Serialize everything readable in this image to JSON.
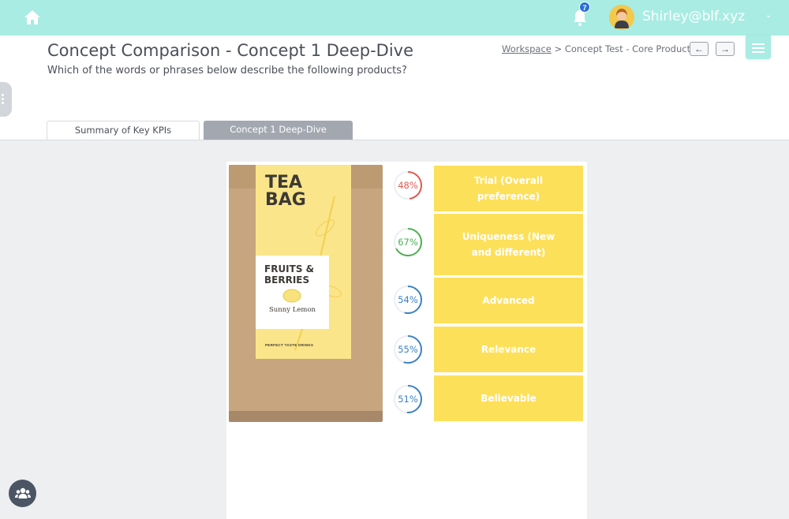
{
  "topbar": {
    "bg_color": "#a8ece3",
    "home_icon": "home-icon",
    "notification_icon": "bell-icon",
    "notification_count": "7",
    "user": "Shirley@blf.xyz",
    "user_menu_icon": "chevron-down-icon"
  },
  "header": {
    "title": "Concept Comparison - Concept 1 Deep-Dive",
    "subtitle": "Which of the words or phrases below describe the following products?",
    "breadcrumb": {
      "link": "Workspace",
      "separator": ">",
      "current": "Concept Test - Core Product"
    },
    "prev_icon": "arrow-left-icon",
    "next_icon": "arrow-right-icon",
    "menu_icon": "hamburger-icon"
  },
  "tabs": [
    {
      "label": "Summary of Key KPIs",
      "active": false
    },
    {
      "label": "Concept 1 Deep-Dive",
      "active": true
    }
  ],
  "product": {
    "brand": "TEA BAG",
    "brand_line1": "TEA",
    "brand_line2": "BAG",
    "name_line1": "FRUITS &",
    "name_line2": "BERRIES",
    "flavor": "Sunny Lemon",
    "tagline": "PERFECT TASTE DRINKS"
  },
  "kpis": [
    {
      "percent": 48,
      "label": "48%",
      "metric": "Trial (Overall preference)",
      "color": "#e05a4f"
    },
    {
      "percent": 67,
      "label": "67%",
      "metric": "Uniqueness (New and different)",
      "color": "#4caf50"
    },
    {
      "percent": 54,
      "label": "54%",
      "metric": "Advanced",
      "color": "#3b82c4"
    },
    {
      "percent": 55,
      "label": "55%",
      "metric": "Relevance",
      "color": "#3b82c4"
    },
    {
      "percent": 51,
      "label": "51%",
      "metric": "Believable",
      "color": "#3b82c4"
    }
  ],
  "kpi_box_color": "#fde05a",
  "bottom_icon": "group-icon"
}
